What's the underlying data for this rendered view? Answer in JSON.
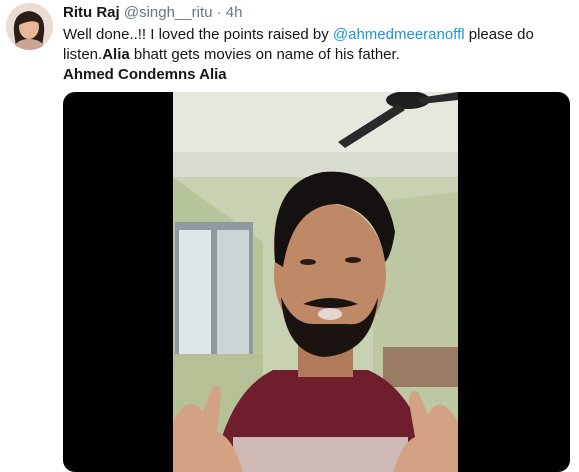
{
  "tweet": {
    "author_name": "Ritu Raj",
    "author_handle": "@singh__ritu",
    "separator": "·",
    "time": "4h",
    "text_part1": "Well done..!! I loved the points raised by ",
    "mention": "@ahmedmeeranoffl",
    "text_part2": " please do listen.",
    "bold_word": "Alia",
    "text_part3": " bhatt gets movies on name of his father.",
    "hashtag_line": "Ahmed Condemns Alia"
  },
  "colors": {
    "link": "#1b95e0",
    "meta": "#657786",
    "text": "#14171a",
    "media_bg": "#000000"
  }
}
